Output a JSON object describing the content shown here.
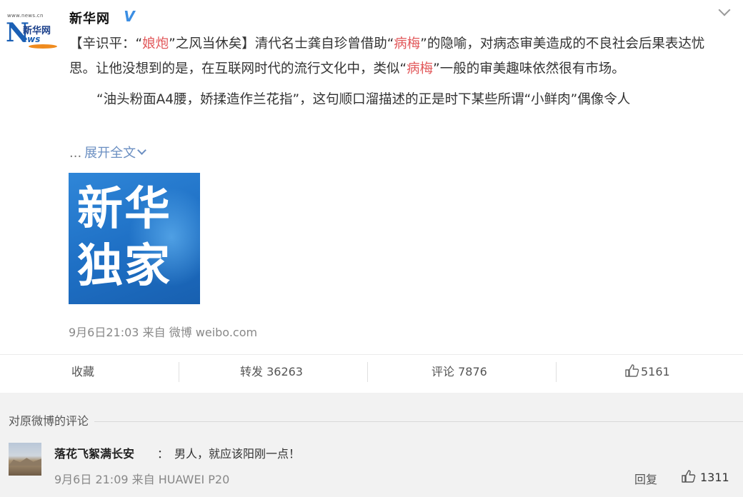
{
  "account": {
    "logo_url_text": "www.news.cn",
    "logo_letter": "N",
    "logo_cn": "新华网",
    "logo_ews": "ews",
    "name": "新华网",
    "verified_mark": "V"
  },
  "post": {
    "line1_a": "【辛识平：“",
    "line1_hl": "娘炮",
    "line1_b": "”之风当休矣】清代名士龚自珍曾借助“",
    "line1_hl2": "病梅",
    "line1_c": "”的隐喻，对病态审美造成的不良社会后果表达忧思。让他没想到的是，在互联网时代的流行文化中，类似“",
    "line1_hl3": "病梅",
    "line1_d": "”一般的审美趣味依然很有市场。",
    "para2": "“油头粉面A4腰，娇揉造作兰花指”，这句顺口溜描述的正是时下某些所谓“小鲜肉”偶像令人",
    "expand_dots": "...",
    "expand_label": "展开全文",
    "image_line1": "新华",
    "image_line2": "独家",
    "meta_time": "9月6日21:03",
    "meta_from": "来自",
    "meta_source": "微博 weibo.com"
  },
  "actions": {
    "favorite": "收藏",
    "repost": "转发 36263",
    "comment": "评论 7876",
    "like_count": "5161"
  },
  "comments": {
    "heading": "对原微博的评论",
    "items": [
      {
        "user": "落花飞絮满长安",
        "separator": "：",
        "text": "男人，就应该阳刚一点！",
        "meta": "9月6日 21:09 来自 HUAWEI P20",
        "reply": "回复",
        "likes": "1311"
      }
    ]
  }
}
